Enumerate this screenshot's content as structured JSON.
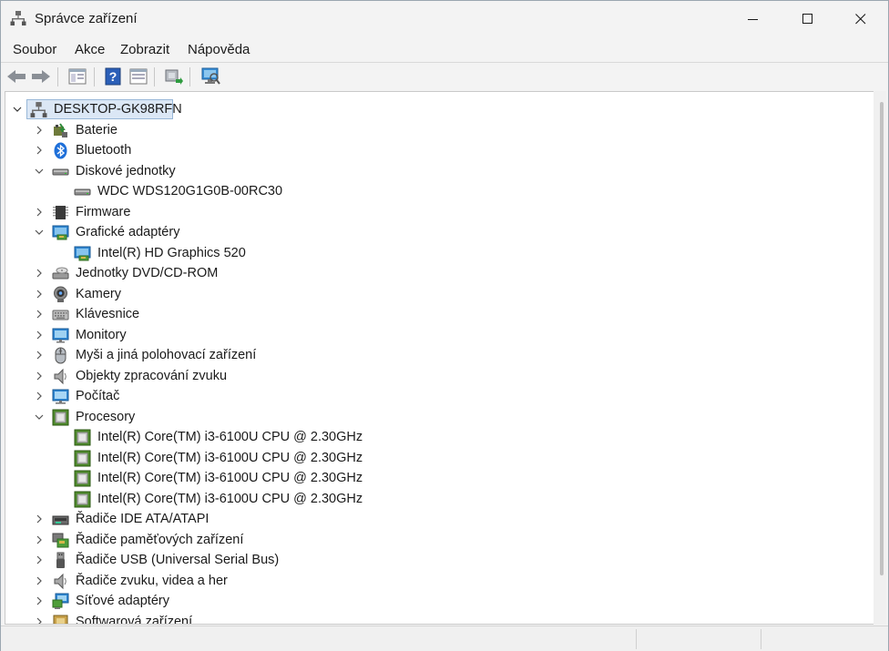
{
  "window": {
    "title": "Správce zařízení",
    "icon": "device-manager-icon"
  },
  "menu": {
    "items": [
      "Soubor",
      "Akce",
      "Zobrazit",
      "Nápověda"
    ]
  },
  "toolbar": {
    "buttons": [
      "back-icon",
      "forward-icon",
      "properties-view-icon",
      "help-icon",
      "console-tree-icon",
      "update-driver-icon",
      "scan-hardware-icon"
    ]
  },
  "tree": {
    "root": "DESKTOP-GK98RFN",
    "items": [
      {
        "label": "Baterie",
        "level": 1,
        "expanded": false,
        "icon": "battery-icon"
      },
      {
        "label": "Bluetooth",
        "level": 1,
        "expanded": false,
        "icon": "bluetooth-icon"
      },
      {
        "label": "Diskové jednotky",
        "level": 1,
        "expanded": true,
        "icon": "disk-drive-icon"
      },
      {
        "label": "WDC WDS120G1G0B-00RC30",
        "level": 2,
        "icon": "disk-drive-icon"
      },
      {
        "label": "Firmware",
        "level": 1,
        "expanded": false,
        "icon": "firmware-icon"
      },
      {
        "label": "Grafické adaptéry",
        "level": 1,
        "expanded": true,
        "icon": "display-adapter-icon"
      },
      {
        "label": "Intel(R) HD Graphics 520",
        "level": 2,
        "icon": "display-adapter-icon"
      },
      {
        "label": "Jednotky DVD/CD-ROM",
        "level": 1,
        "expanded": false,
        "icon": "dvd-drive-icon"
      },
      {
        "label": "Kamery",
        "level": 1,
        "expanded": false,
        "icon": "camera-icon"
      },
      {
        "label": "Klávesnice",
        "level": 1,
        "expanded": false,
        "icon": "keyboard-icon"
      },
      {
        "label": "Monitory",
        "level": 1,
        "expanded": false,
        "icon": "monitor-icon"
      },
      {
        "label": "Myši a jiná polohovací zařízení",
        "level": 1,
        "expanded": false,
        "icon": "mouse-icon"
      },
      {
        "label": "Objekty zpracování zvuku",
        "level": 1,
        "expanded": false,
        "icon": "speaker-icon"
      },
      {
        "label": "Počítač",
        "level": 1,
        "expanded": false,
        "icon": "computer-icon"
      },
      {
        "label": "Procesory",
        "level": 1,
        "expanded": true,
        "icon": "processor-icon"
      },
      {
        "label": "Intel(R) Core(TM) i3-6100U CPU @ 2.30GHz",
        "level": 2,
        "icon": "processor-icon"
      },
      {
        "label": "Intel(R) Core(TM) i3-6100U CPU @ 2.30GHz",
        "level": 2,
        "icon": "processor-icon"
      },
      {
        "label": "Intel(R) Core(TM) i3-6100U CPU @ 2.30GHz",
        "level": 2,
        "icon": "processor-icon"
      },
      {
        "label": "Intel(R) Core(TM) i3-6100U CPU @ 2.30GHz",
        "level": 2,
        "icon": "processor-icon"
      },
      {
        "label": "Řadiče IDE ATA/ATAPI",
        "level": 1,
        "expanded": false,
        "icon": "ide-controller-icon"
      },
      {
        "label": "Řadiče paměťových zařízení",
        "level": 1,
        "expanded": false,
        "icon": "storage-controller-icon"
      },
      {
        "label": "Řadiče USB (Universal Serial Bus)",
        "level": 1,
        "expanded": false,
        "icon": "usb-icon"
      },
      {
        "label": "Řadiče zvuku, videa a her",
        "level": 1,
        "expanded": false,
        "icon": "speaker-icon"
      },
      {
        "label": "Síťové adaptéry",
        "level": 1,
        "expanded": false,
        "icon": "network-adapter-icon"
      },
      {
        "label": "Softwarová zařízení",
        "level": 1,
        "expanded": false,
        "icon": "software-device-icon"
      }
    ]
  }
}
